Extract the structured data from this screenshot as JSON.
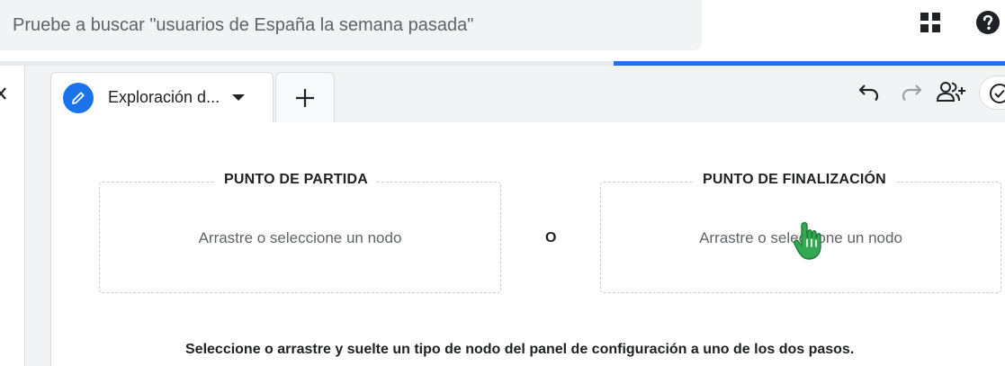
{
  "search": {
    "placeholder": "Pruebe a buscar \"usuarios de España la semana pasada\""
  },
  "header": {
    "apps_icon": "apps-grid-icon",
    "help_icon": "help-circle-icon"
  },
  "progress": {
    "value_percent": 39
  },
  "tabs": [
    {
      "label": "Exploración d...",
      "icon": "pencil-icon",
      "active": true
    },
    {
      "label": "+",
      "icon": "add-icon"
    }
  ],
  "toolbar": {
    "icons": [
      "undo-icon",
      "redo-icon",
      "share-user-icon",
      "check-circle-icon"
    ]
  },
  "canvas": {
    "start": {
      "title": "PUNTO DE PARTIDA",
      "hint": "Arrastre o seleccione un nodo"
    },
    "or_label": "O",
    "end": {
      "title": "PUNTO DE FINALIZACIÓN",
      "hint": "Arrastre o seleccione un nodo"
    },
    "instructions": "Seleccione o arrastre y suelte un tipo de nodo del panel de configuración a uno de los dos pasos."
  },
  "colors": {
    "accent": "#1a73e8",
    "cursor": "#34a853"
  }
}
